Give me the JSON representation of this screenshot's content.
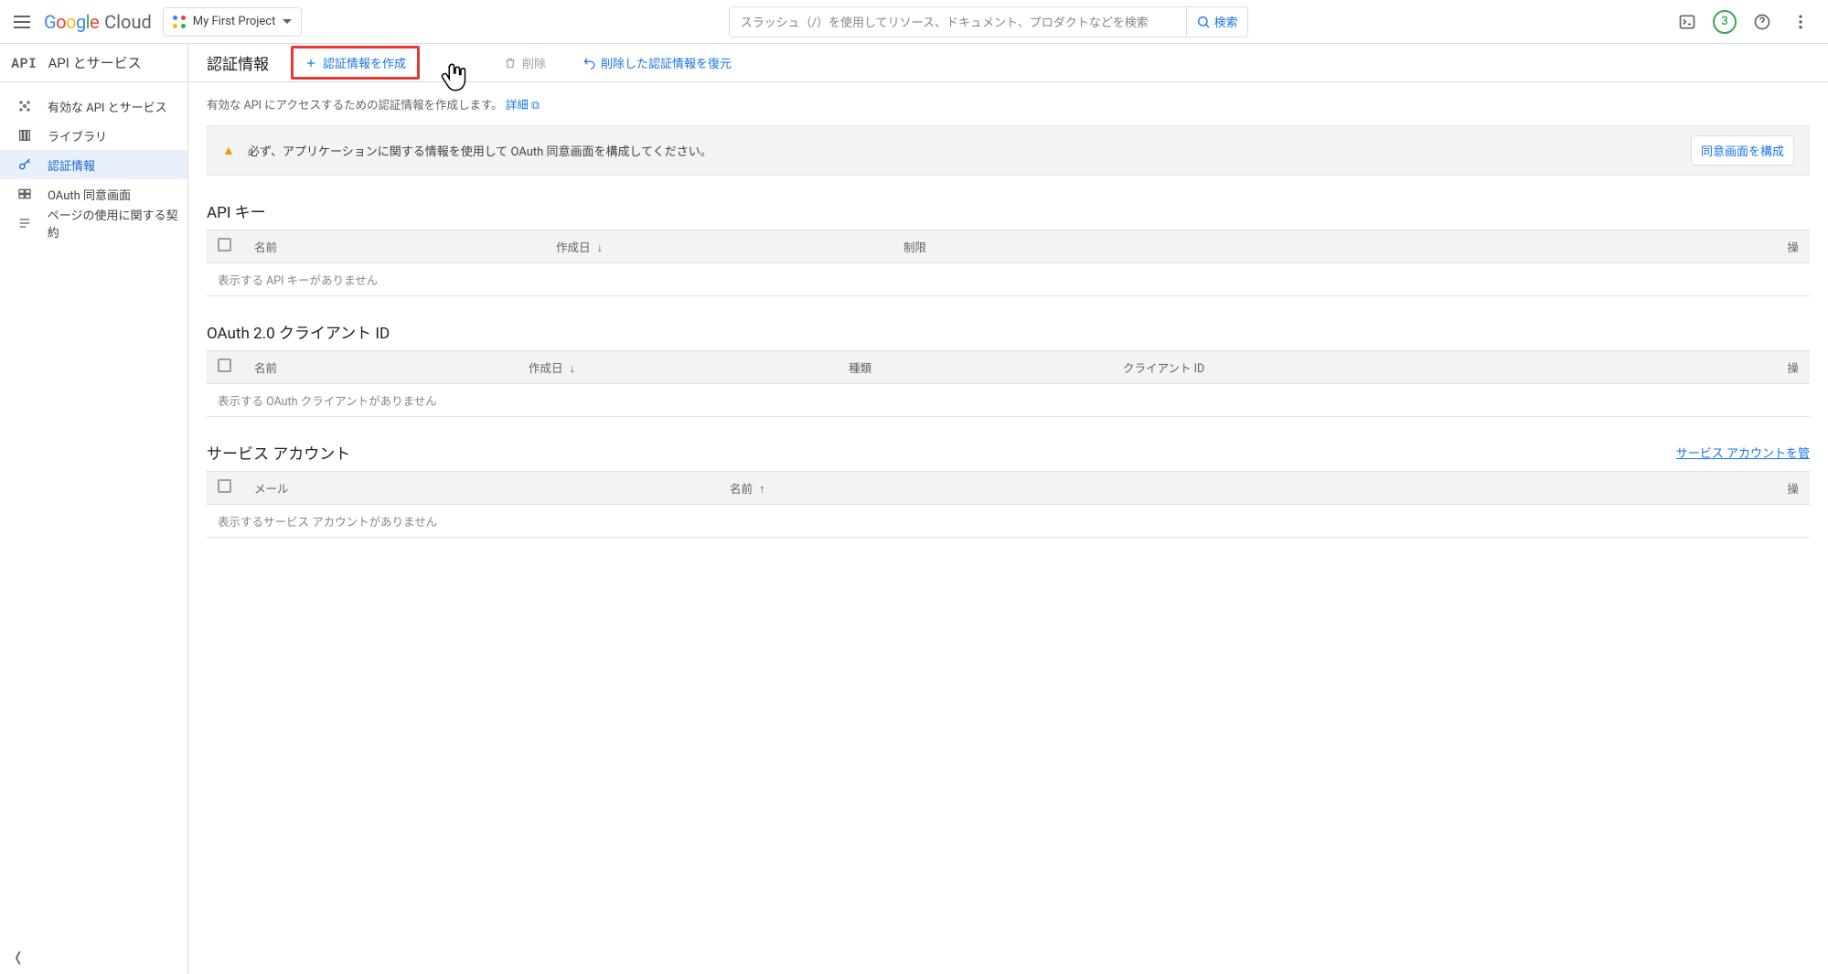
{
  "topbar": {
    "brand_google": "Google",
    "brand_cloud": "Cloud",
    "project_name": "My First Project",
    "search_placeholder": "スラッシュ（/）を使用してリソース、ドキュメント、プロダクトなどを検索",
    "search_button": "検索",
    "notification_count": "3"
  },
  "sidebar": {
    "section_badge": "API",
    "section_title": "API とサービス",
    "items": [
      {
        "icon": "enabled-apis-icon",
        "label": "有効な API とサービス"
      },
      {
        "icon": "library-icon",
        "label": "ライブラリ"
      },
      {
        "icon": "key-icon",
        "label": "認証情報"
      },
      {
        "icon": "consent-icon",
        "label": "OAuth 同意画面"
      },
      {
        "icon": "tos-icon",
        "label": "ページの使用に関する契約"
      }
    ]
  },
  "actionbar": {
    "title": "認証情報",
    "create": "認証情報を作成",
    "delete": "削除",
    "restore": "削除した認証情報を復元"
  },
  "hint": {
    "text": "有効な API にアクセスするための認証情報を作成します。",
    "link": "詳細"
  },
  "warn": {
    "text": "必ず、アプリケーションに関する情報を使用して OAuth 同意画面を構成してください。",
    "button": "同意画面を構成"
  },
  "sections": {
    "api_keys": {
      "heading": "API キー",
      "cols": {
        "name": "名前",
        "created": "作成日",
        "restrict": "制限",
        "actions": "操"
      },
      "empty": "表示する API キーがありません"
    },
    "oauth": {
      "heading": "OAuth 2.0 クライアント ID",
      "cols": {
        "name": "名前",
        "created": "作成日",
        "type": "種類",
        "client_id": "クライアント ID",
        "actions": "操"
      },
      "empty": "表示する OAuth クライアントがありません"
    },
    "svc": {
      "heading": "サービス アカウント",
      "manage_link": "サービス アカウントを管",
      "cols": {
        "email": "メール",
        "name": "名前",
        "actions": "操"
      },
      "empty": "表示するサービス アカウントがありません"
    }
  }
}
